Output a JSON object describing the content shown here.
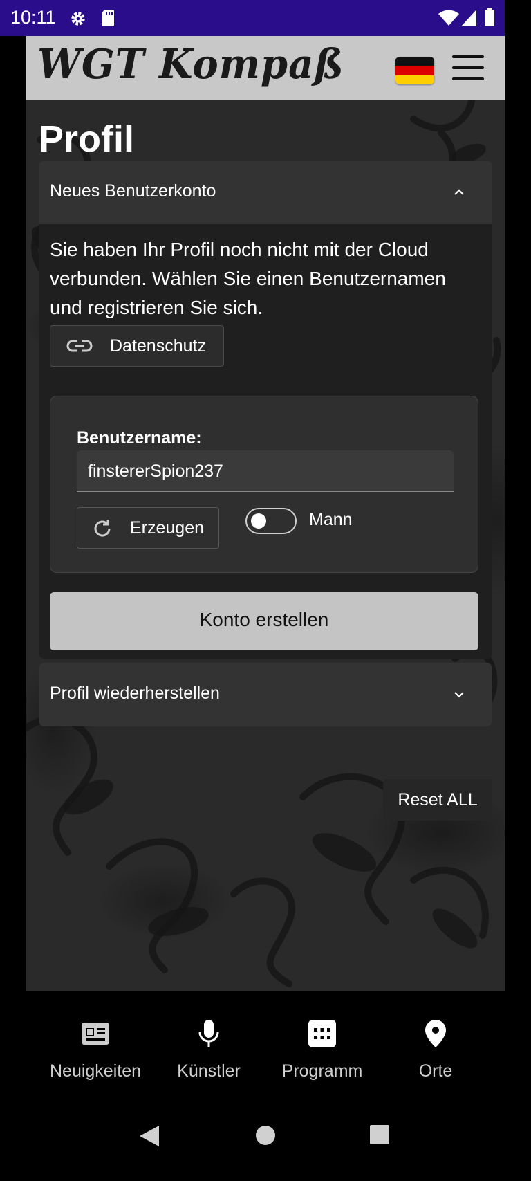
{
  "status_bar": {
    "time": "10:11",
    "icons": [
      "gear-icon",
      "sd-card-icon",
      "wifi-icon",
      "signal-icon",
      "battery-icon"
    ]
  },
  "app_bar": {
    "logo": "WGT Kompaß",
    "language_flag": "german-flag-icon",
    "menu_icon": "hamburger-menu-icon"
  },
  "page": {
    "title": "Profil"
  },
  "new_account_panel": {
    "title": "Neues Benutzerkonto",
    "expanded": true,
    "intro_text": "Sie haben Ihr Profil noch nicht mit der Cloud verbunden. Wählen Sie einen Benutzernamen und registrieren Sie sich.",
    "privacy_button": "Datenschutz",
    "username_label": "Benutzername:",
    "username_value": "finstererSpion237",
    "generate_button": "Erzeugen",
    "gender_toggle_label": "Mann",
    "gender_toggle_on": false,
    "create_button": "Konto erstellen"
  },
  "restore_panel": {
    "title": "Profil wiederherstellen",
    "expanded": false
  },
  "reset_button": "Reset ALL",
  "bottom_nav": {
    "items": [
      {
        "label": "Neuigkeiten",
        "icon": "newspaper-icon"
      },
      {
        "label": "Künstler",
        "icon": "microphone-icon"
      },
      {
        "label": "Programm",
        "icon": "calendar-grid-icon"
      },
      {
        "label": "Orte",
        "icon": "location-pin-icon"
      }
    ]
  },
  "colors": {
    "status_bar": "#2a0d8a",
    "app_bar": "#c8c8c8",
    "panel": "#333333",
    "primary_button": "#c4c4c4"
  }
}
